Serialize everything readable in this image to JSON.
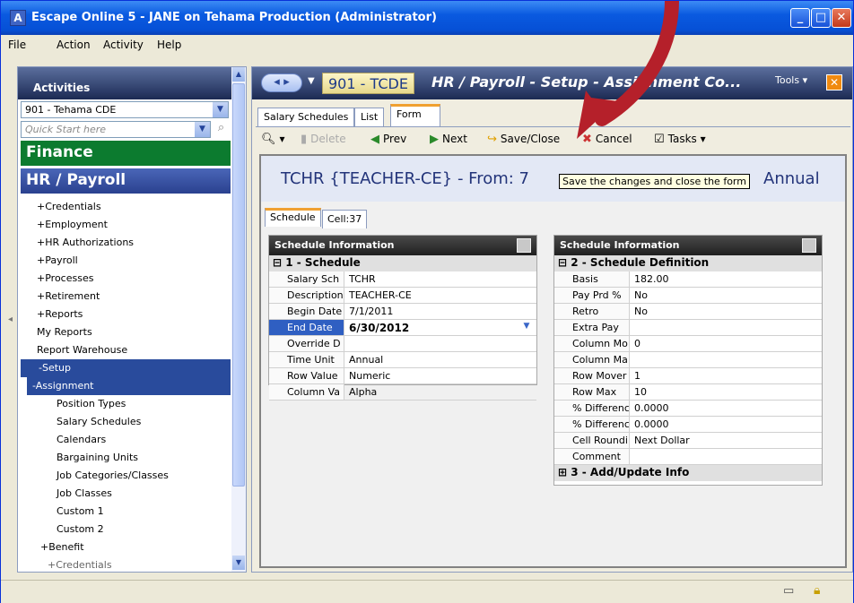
{
  "window": {
    "title": "Escape Online 5 - JANE on Tehama Production (Administrator)"
  },
  "menu": [
    "File",
    "Action",
    "Activity",
    "Help"
  ],
  "activities": {
    "header": "Activities",
    "district": "901 - Tehama CDE",
    "quick_start_placeholder": "Quick Start here",
    "finance": "Finance",
    "hr_payroll": "HR / Payroll",
    "items": [
      {
        "label": "+Credentials"
      },
      {
        "label": "+Employment"
      },
      {
        "label": "+HR Authorizations"
      },
      {
        "label": "+Payroll"
      },
      {
        "label": "+Processes"
      },
      {
        "label": "+Retirement"
      },
      {
        "label": "+Reports"
      },
      {
        "label": "My Reports"
      },
      {
        "label": "Report Warehouse"
      },
      {
        "label": "-Setup"
      },
      {
        "label": "-Assignment"
      },
      {
        "label": "Position Types"
      },
      {
        "label": "Salary Schedules"
      },
      {
        "label": "Calendars"
      },
      {
        "label": "Bargaining Units"
      },
      {
        "label": "Job Categories/Classes"
      },
      {
        "label": "Job Classes"
      },
      {
        "label": "Custom 1"
      },
      {
        "label": "Custom 2"
      },
      {
        "label": "+Benefit"
      },
      {
        "label": "+Credentials"
      }
    ]
  },
  "form": {
    "id": "901 - TCDE",
    "title": "HR / Payroll - Setup - Assignment Co...",
    "tools": "Tools",
    "tabs": [
      "Salary Schedules",
      "List",
      "Form"
    ],
    "toolbar": {
      "delete": "Delete",
      "prev": "Prev",
      "next": "Next",
      "save_close": "Save/Close",
      "cancel": "Cancel",
      "tasks": "Tasks"
    },
    "heading_left": "TCHR {TEACHER-CE} - From: 7",
    "heading_right": "Annual",
    "tooltip": "Save the changes and close the form",
    "subtabs": [
      "Schedule",
      "Cell:37"
    ]
  },
  "left_panel": {
    "header": "Schedule Information",
    "section": "1 - Schedule",
    "rows": [
      {
        "label": "Salary Sch",
        "value": "TCHR"
      },
      {
        "label": "Description",
        "value": "TEACHER-CE"
      },
      {
        "label": "Begin Date",
        "value": "7/1/2011"
      },
      {
        "label": "End Date",
        "value": "6/30/2012"
      },
      {
        "label": "Override D",
        "value": ""
      },
      {
        "label": "Time Unit",
        "value": "Annual"
      },
      {
        "label": "Row Value",
        "value": "Numeric"
      },
      {
        "label": "Column Va",
        "value": "Alpha"
      }
    ]
  },
  "right_panel": {
    "header": "Schedule Information",
    "section": "2 - Schedule Definition",
    "rows": [
      {
        "label": "Basis",
        "value": "182.00"
      },
      {
        "label": "Pay Prd %",
        "value": "No"
      },
      {
        "label": "Retro",
        "value": "No"
      },
      {
        "label": "Extra Pay",
        "value": ""
      },
      {
        "label": "Column Mo",
        "value": "0"
      },
      {
        "label": "Column Ma",
        "value": ""
      },
      {
        "label": "Row Mover",
        "value": "1"
      },
      {
        "label": "Row Max",
        "value": "10"
      },
      {
        "label": "% Differenc",
        "value": "0.0000"
      },
      {
        "label": "% Differenc",
        "value": "0.0000"
      },
      {
        "label": "Cell Roundi",
        "value": "Next Dollar"
      },
      {
        "label": "Comment",
        "value": ""
      }
    ],
    "section3": "3 - Add/Update Info"
  },
  "colors": {
    "titlebar": "#0a5ae0",
    "finance": "#0c7b2f",
    "hr": "#2a418f",
    "selected": "#294b9c",
    "tab_accent": "#f0a030",
    "arrow": "#b5202a"
  }
}
